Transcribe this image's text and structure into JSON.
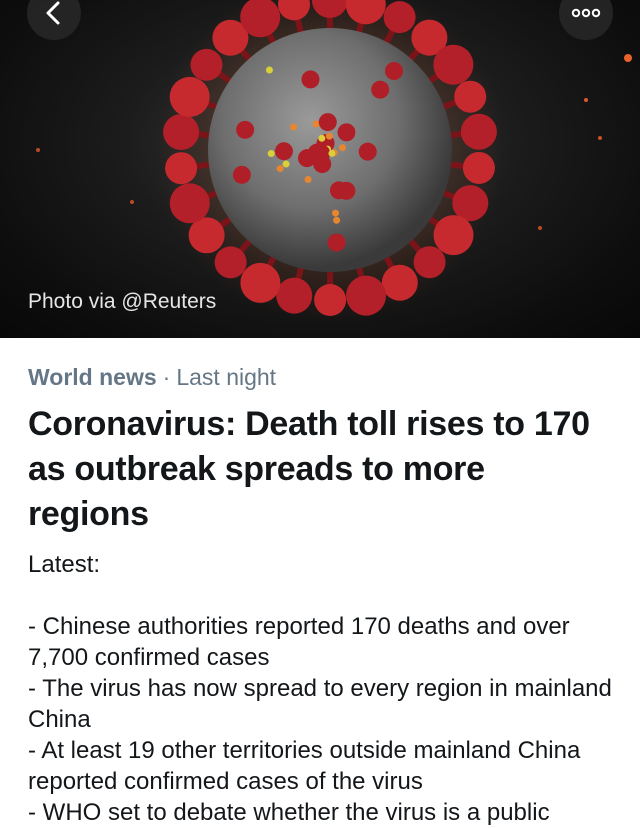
{
  "header": {
    "back_icon": "chevron-left-icon",
    "more_icon": "more-horizontal-icon"
  },
  "hero": {
    "caption": "Photo via @Reuters"
  },
  "article": {
    "category": "World news",
    "separator": "·",
    "time": "Last night",
    "headline": "Coronavirus: Death toll rises to 170 as outbreak spreads to more regions",
    "body": {
      "intro": "Latest:",
      "bullets": [
        "- Chinese authorities reported 170 deaths and over 7,700 confirmed cases",
        "- The virus has now spread to every region in mainland China",
        "- At least 19 other territories outside mainland China reported confirmed cases of the virus",
        "- WHO set to debate whether the virus is a public"
      ]
    }
  },
  "colors": {
    "meta_gray": "#657786",
    "text_dark": "#14171a",
    "spike_red": "#b3202a"
  }
}
